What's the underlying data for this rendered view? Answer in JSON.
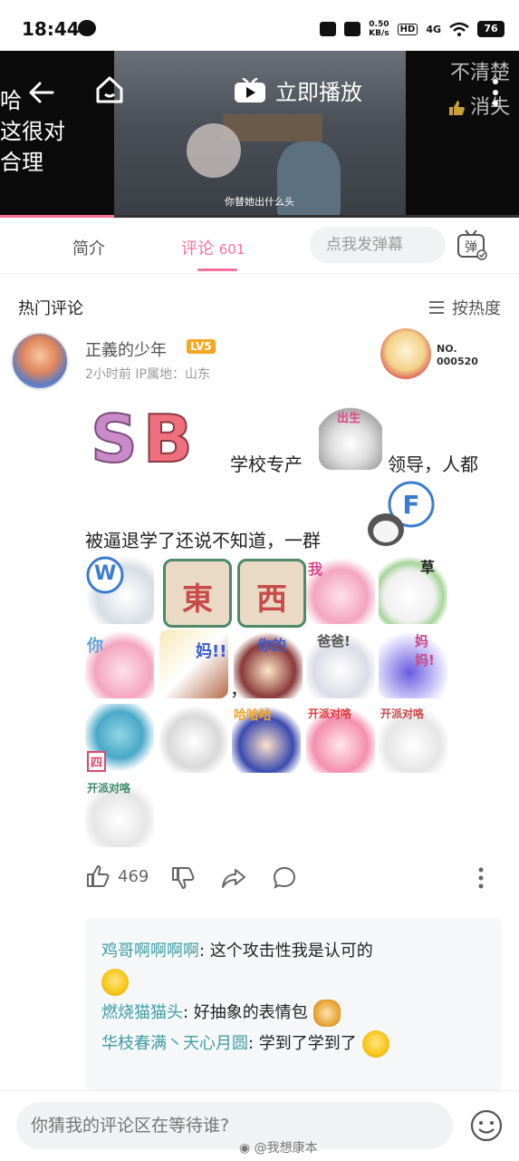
{
  "status_bar": {
    "time": "18:44",
    "speed_value": "0.50",
    "speed_unit": "KB/s",
    "hd": "HD",
    "network": "4G",
    "battery": "76"
  },
  "video": {
    "play_label": "立即播放",
    "subtitle": "你替她出什么头",
    "left_overlay": [
      "哈",
      "这很对",
      "合理"
    ],
    "right_overlay": [
      "不清楚",
      "消失"
    ],
    "progress": 0.22
  },
  "tabs": {
    "intro": "简介",
    "comments": "评论",
    "comment_count": "601",
    "danmaku_placeholder": "点我发弹幕",
    "danmaku_button": "弹"
  },
  "hot": {
    "title": "热门评论",
    "sort_label": "按热度"
  },
  "comment": {
    "username": "正義的少年",
    "level": "LV5",
    "time": "2小时前",
    "ip": "IP属地：山东",
    "fan_badge": {
      "label": "NO.",
      "number": "000520"
    },
    "sb_letters": [
      "S",
      "B"
    ],
    "text_1": "学校专产",
    "text_2": "领导，人都",
    "text_3": "被逼退学了还说不知道，一群",
    "comma": "，",
    "sticker_inline_1_label": "出生",
    "sticker_inline_2_label": "F",
    "stickers": [
      {
        "name": "w-sticker",
        "label": "W"
      },
      {
        "name": "dong-sticker",
        "label": "東"
      },
      {
        "name": "xi-sticker",
        "label": "西"
      },
      {
        "name": "wo-sticker",
        "label": "我"
      },
      {
        "name": "cao-sticker",
        "label": "草"
      },
      {
        "name": "ni-sticker",
        "label": "你"
      },
      {
        "name": "ma-sticker",
        "label": "妈!!"
      },
      {
        "name": "nide-sticker",
        "label": "你的"
      },
      {
        "name": "baba-sticker",
        "label": "爸爸!"
      },
      {
        "name": "mama-sticker",
        "label": "妈妈!"
      },
      {
        "name": "si-sticker",
        "label": "四"
      },
      {
        "name": "maid-sticker",
        "label": ""
      },
      {
        "name": "haha-sticker",
        "label": "哈哈哈"
      },
      {
        "name": "party-sticker-1",
        "label": "开派对咯"
      },
      {
        "name": "party-sticker-2",
        "label": "开派对咯"
      },
      {
        "name": "party-sticker-3",
        "label": "开派对咯"
      }
    ],
    "likes": "469"
  },
  "replies": [
    {
      "user": "鸡哥啊啊啊啊",
      "text": ": 这个攻击性我是认可的"
    },
    {
      "user": "燃烧猫猫头",
      "text": ": 好抽象的表情包"
    },
    {
      "user": "华枝春满丶天心月圆",
      "text": ": 学到了学到了"
    }
  ],
  "bottom": {
    "input_placeholder": "你猜我的评论区在等待谁?",
    "watermark": "@我想康本"
  },
  "colors": {
    "accent": "#fb7299",
    "reply_user": "#3f9ea5"
  }
}
